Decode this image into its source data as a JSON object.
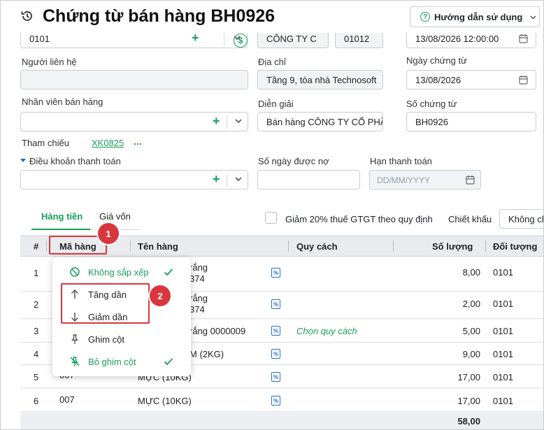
{
  "header": {
    "title": "Chứng từ bán hàng BH0926",
    "help_label": "Hướng dẫn sử dụng"
  },
  "form": {
    "customer_code": "0101",
    "customer_name": "CÔNG TY C",
    "customer_code2": "01012",
    "top_date": "13/08/2026 12:00:00",
    "contact_label": "Người liên hệ",
    "contact_value": "",
    "address_label": "Địa chỉ",
    "address_value": "Tầng 9, tòa nhà Technosoft",
    "voucher_date_label": "Ngày chứng từ",
    "voucher_date_value": "13/08/2026",
    "sales_staff_label": "Nhân viên bán hàng",
    "sales_staff_value": "",
    "description_label": "Diễn giải",
    "description_value": "Bán hàng CÔNG TY CỔ PHẦN",
    "voucher_no_label": "Số chứng từ",
    "voucher_no_value": "BH0926",
    "reference_label": "Tham chiếu",
    "reference_link": "XK0825",
    "reference_more": "...",
    "payment_terms_label": "Điều khoản thanh toán",
    "payment_terms_value": "",
    "credit_days_label": "Số ngày được nợ",
    "credit_days_value": "",
    "due_date_label": "Hạn thanh toán",
    "due_date_placeholder": "DD/MM/YYYY"
  },
  "tabs": [
    {
      "label": "Hàng tiền",
      "active": true
    },
    {
      "label": "Giá vốn",
      "active": false
    }
  ],
  "options": {
    "vat_reduction_label": "Giảm 20% thuế GTGT theo quy định",
    "vat_reduction_checked": false,
    "discount_label": "Chiết khấu",
    "discount_value": "Không chiết khấu"
  },
  "table": {
    "columns": [
      "#",
      "Mã hàng",
      "Tên hàng",
      "Quy cách",
      "Số lượng",
      "Đối tượng"
    ],
    "rows": [
      {
        "no": "1",
        "code": "",
        "name_line1": "rắng",
        "name_line2": "374",
        "spec": "",
        "qty": "8,00",
        "object": "0101"
      },
      {
        "no": "2",
        "code": "",
        "name_line1": "rắng",
        "name_line2": "374",
        "spec": "",
        "qty": "2,00",
        "object": "0101"
      },
      {
        "no": "3",
        "code": "",
        "name_line1": "rắng 0000009",
        "name_line2": "",
        "spec": "Chọn quy cách",
        "qty": "5,00",
        "object": "0101"
      },
      {
        "no": "4",
        "code": "",
        "name_line1": "M (2KG)",
        "name_line2": "",
        "spec": "",
        "qty": "9,00",
        "object": "0101"
      },
      {
        "no": "5",
        "code": "007",
        "name_line1": "MỰC (10KG)",
        "name_line2": "",
        "spec": "",
        "qty": "17,00",
        "object": "0101"
      },
      {
        "no": "6",
        "code": "007",
        "name_line1": "MỰC (10KG)",
        "name_line2": "",
        "spec": "",
        "qty": "17,00",
        "object": "0101"
      }
    ],
    "total_qty": "58,00"
  },
  "sort_menu": {
    "items": [
      {
        "label": "Không sắp xếp",
        "icon": "no-sort-icon",
        "checked": true,
        "highlight": true
      },
      {
        "label": "Tăng dần",
        "icon": "arrow-up-icon",
        "checked": false,
        "highlight": false
      },
      {
        "label": "Giảm dần",
        "icon": "arrow-down-icon",
        "checked": false,
        "highlight": false
      },
      {
        "label": "Ghim cột",
        "icon": "pin-icon",
        "checked": false,
        "highlight": false
      },
      {
        "label": "Bỏ ghim cột",
        "icon": "unpin-icon",
        "checked": true,
        "highlight": true
      }
    ]
  },
  "callouts": [
    "1",
    "2"
  ],
  "colors": {
    "accent": "#1a9e5a",
    "callout": "#d9363e",
    "link_blue": "#2670c9"
  }
}
